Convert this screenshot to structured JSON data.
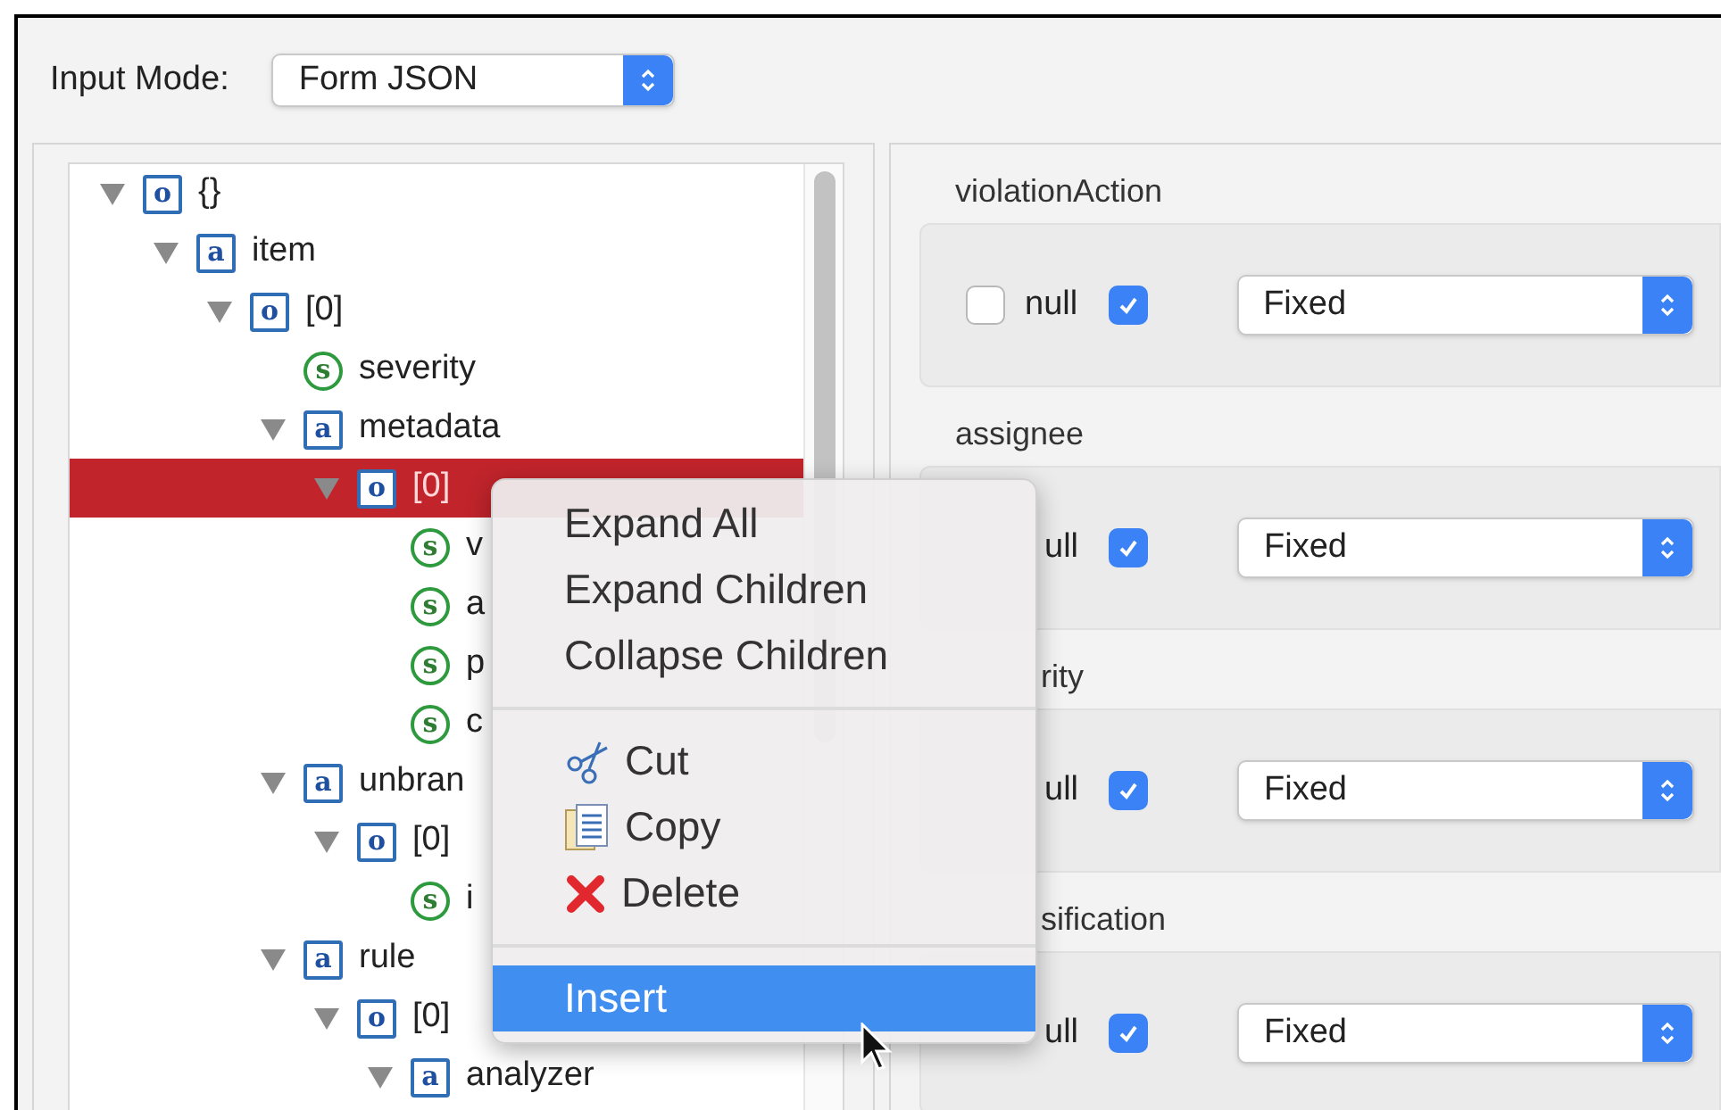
{
  "input_mode": {
    "label": "Input Mode:",
    "value": "Form JSON"
  },
  "tree": [
    {
      "label": "{}",
      "kind": "object",
      "badge": "o",
      "expanded": true,
      "selected": false,
      "children": [
        {
          "label": "item",
          "kind": "array",
          "badge": "a",
          "expanded": true,
          "selected": false,
          "children": [
            {
              "label": "[0]",
              "kind": "object",
              "badge": "o",
              "expanded": true,
              "selected": false,
              "children": [
                {
                  "label": "severity",
                  "kind": "string",
                  "badge": "s",
                  "selected": false
                },
                {
                  "label": "metadata",
                  "kind": "array",
                  "badge": "a",
                  "expanded": true,
                  "selected": false,
                  "children": [
                    {
                      "label": "[0]",
                      "kind": "object",
                      "badge": "o",
                      "expanded": true,
                      "selected": true,
                      "children": [
                        {
                          "label": "v",
                          "kind": "string",
                          "badge": "s",
                          "selected": false
                        },
                        {
                          "label": "a",
                          "kind": "string",
                          "badge": "s",
                          "selected": false
                        },
                        {
                          "label": "p",
                          "kind": "string",
                          "badge": "s",
                          "selected": false
                        },
                        {
                          "label": "c",
                          "kind": "string",
                          "badge": "s",
                          "selected": false
                        }
                      ]
                    }
                  ]
                },
                {
                  "label": "unbran",
                  "kind": "array",
                  "badge": "a",
                  "expanded": true,
                  "selected": false,
                  "children": [
                    {
                      "label": "[0]",
                      "kind": "object",
                      "badge": "o",
                      "expanded": true,
                      "selected": false,
                      "children": [
                        {
                          "label": "i",
                          "kind": "string",
                          "badge": "s",
                          "selected": false
                        }
                      ]
                    }
                  ]
                },
                {
                  "label": "rule",
                  "kind": "array",
                  "badge": "a",
                  "expanded": true,
                  "selected": false,
                  "children": [
                    {
                      "label": "[0]",
                      "kind": "object",
                      "badge": "o",
                      "expanded": true,
                      "selected": false,
                      "children": [
                        {
                          "label": "analyzer",
                          "kind": "array",
                          "badge": "a",
                          "expanded": true,
                          "selected": false
                        }
                      ]
                    }
                  ]
                }
              ]
            }
          ]
        }
      ]
    }
  ],
  "sections": [
    {
      "label": "violationAction",
      "covered": false,
      "null_checkbox": {
        "checked": false
      },
      "null_label": "null",
      "enabled": true,
      "value": "Fixed"
    },
    {
      "label": "assignee",
      "covered": false,
      "null_label": "ull",
      "enabled": true,
      "value": "Fixed"
    },
    {
      "label": "rity",
      "covered": true,
      "null_label": "ull",
      "enabled": true,
      "value": "Fixed"
    },
    {
      "label": "sification",
      "covered": true,
      "null_label": "ull",
      "enabled": true,
      "value": "Fixed"
    }
  ],
  "context_menu": [
    {
      "kind": "item",
      "label": "Expand All",
      "selected": false
    },
    {
      "kind": "item",
      "label": "Expand Children",
      "selected": false
    },
    {
      "kind": "item",
      "label": "Collapse Children",
      "selected": false
    },
    {
      "kind": "separator"
    },
    {
      "kind": "cut",
      "label": "Cut",
      "selected": false
    },
    {
      "kind": "copy",
      "label": "Copy",
      "selected": false
    },
    {
      "kind": "delete",
      "label": "Delete",
      "selected": false
    },
    {
      "kind": "separator"
    },
    {
      "kind": "item",
      "label": "Insert",
      "selected": true
    }
  ]
}
